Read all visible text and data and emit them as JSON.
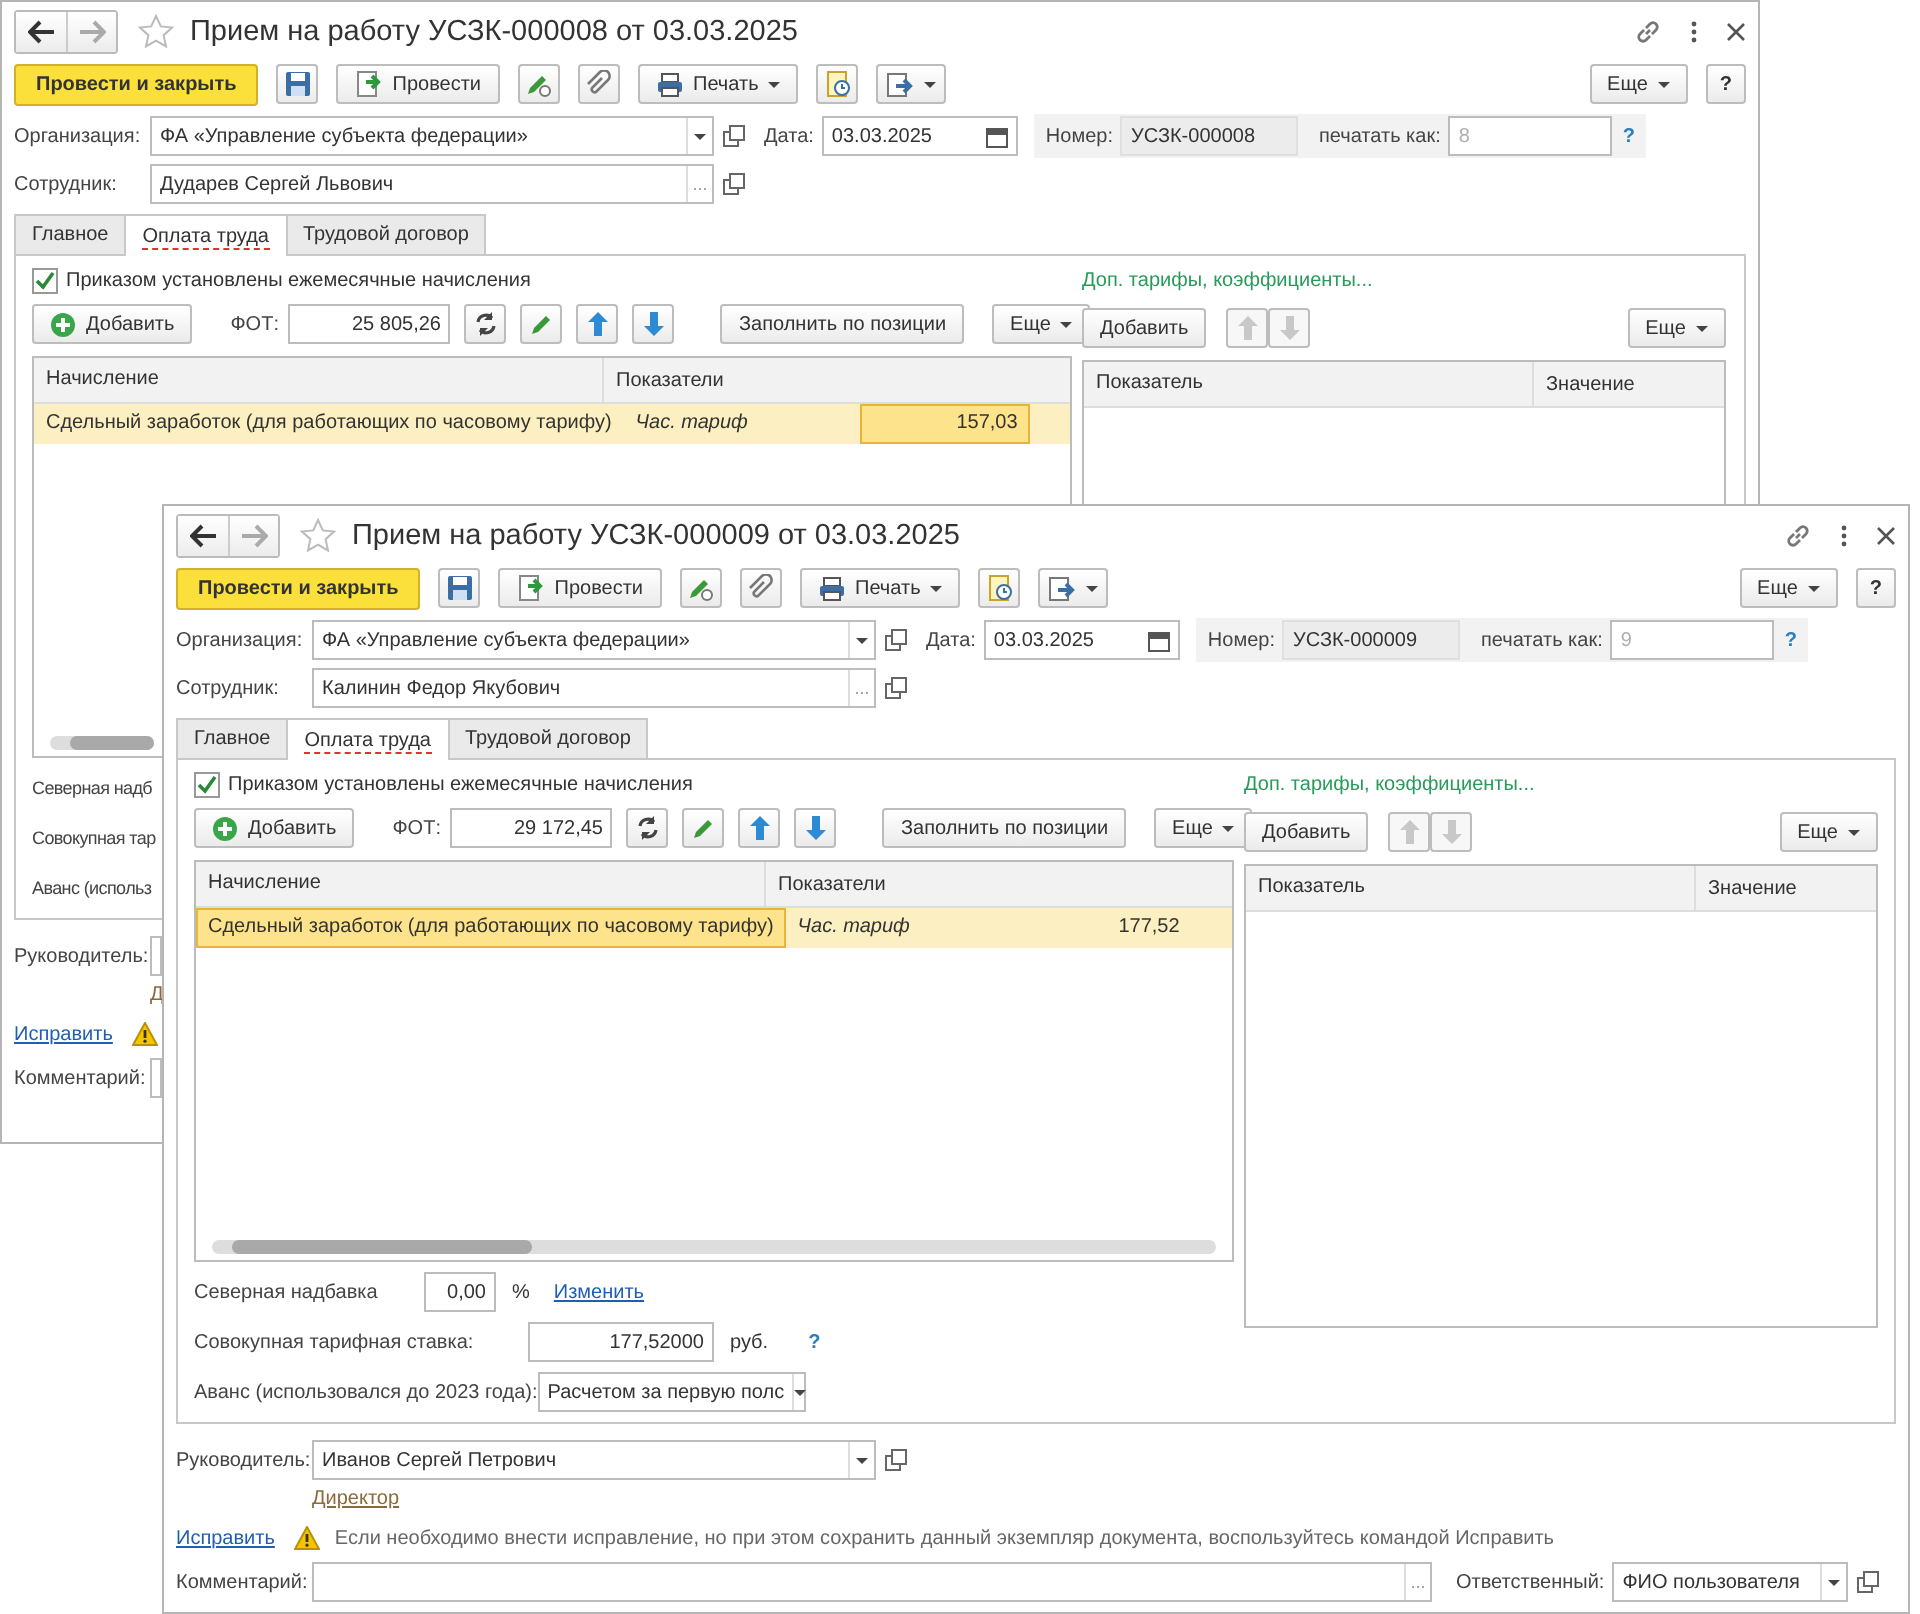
{
  "windows": [
    {
      "kind": "back",
      "title": "Прием на работу УСЗК-000008 от 03.03.2025",
      "toolbar": {
        "post_close": "Провести и закрыть",
        "post": "Провести",
        "print": "Печать",
        "more": "Еще",
        "help": "?"
      },
      "organization": {
        "label": "Организация:",
        "value": "ФА «Управление субъекта федерации»"
      },
      "date": {
        "label": "Дата:",
        "value": "03.03.2025"
      },
      "number": {
        "label": "Номер:",
        "value": "УСЗК-000008"
      },
      "print_as": {
        "label": "печатать как:",
        "value": "8",
        "disabled": true,
        "help": "?"
      },
      "employee": {
        "label": "Сотрудник:",
        "value": "Дударев Сергей Львович",
        "select": "..."
      },
      "tabs": [
        {
          "label": "Главное",
          "selected": false
        },
        {
          "label": "Оплата труда",
          "selected": true
        },
        {
          "label": "Трудовой договор",
          "selected": false
        }
      ],
      "monthly_checkbox": {
        "label": "Приказом установлены ежемесячные начисления",
        "checked": true
      },
      "accruals_toolbar": {
        "add": "Добавить",
        "fot_label": "ФОТ:",
        "fot_value": "25 805,26",
        "fill": "Заполнить по позиции",
        "more": "Еще"
      },
      "accruals_table": {
        "columns": [
          "Начисление",
          "Показатели"
        ],
        "rows": [
          {
            "selected": true,
            "cells": [
              {
                "text": "Сдельный заработок (для работающих по часовому тарифу)",
                "focused": false
              },
              {
                "text": "Час. тариф",
                "focused": false
              },
              {
                "text": "157,03",
                "focused": true
              }
            ]
          }
        ]
      },
      "extra_link": "Доп. тарифы, коэффициенты...",
      "extra_toolbar": {
        "add": "Добавить",
        "more": "Еще"
      },
      "extra_table": {
        "columns": [
          "Показатель",
          "Значение"
        ]
      },
      "north": {
        "label": "Северная надб"
      },
      "total": {
        "label": "Совокупная тар"
      },
      "advance": {
        "label": "Аванс (использ"
      },
      "manager": {
        "label": "Руководитель:"
      },
      "position_link": "Д",
      "fix": {
        "link": "Исправить"
      },
      "comment": {
        "label": "Комментарий:"
      }
    },
    {
      "kind": "front",
      "title": "Прием на работу УСЗК-000009 от 03.03.2025",
      "toolbar": {
        "post_close": "Провести и закрыть",
        "post": "Провести",
        "print": "Печать",
        "more": "Еще",
        "help": "?"
      },
      "organization": {
        "label": "Организация:",
        "value": "ФА «Управление субъекта федерации»"
      },
      "date": {
        "label": "Дата:",
        "value": "03.03.2025"
      },
      "number": {
        "label": "Номер:",
        "value": "УСЗК-000009"
      },
      "print_as": {
        "label": "печатать как:",
        "value": "9",
        "disabled": true,
        "help": "?"
      },
      "employee": {
        "label": "Сотрудник:",
        "value": "Калинин Федор Якубович",
        "select": "..."
      },
      "tabs": [
        {
          "label": "Главное",
          "selected": false
        },
        {
          "label": "Оплата труда",
          "selected": true
        },
        {
          "label": "Трудовой договор",
          "selected": false
        }
      ],
      "monthly_checkbox": {
        "label": "Приказом установлены ежемесячные начисления",
        "checked": true
      },
      "accruals_toolbar": {
        "add": "Добавить",
        "fot_label": "ФОТ:",
        "fot_value": "29 172,45",
        "fill": "Заполнить по позиции",
        "more": "Еще"
      },
      "accruals_table": {
        "columns": [
          "Начисление",
          "Показатели"
        ],
        "rows": [
          {
            "selected": true,
            "cells": [
              {
                "text": "Сдельный заработок (для работающих по часовому тарифу)",
                "focused": true
              },
              {
                "text": "Час. тариф",
                "focused": false
              },
              {
                "text": "177,52",
                "focused": false
              }
            ]
          }
        ]
      },
      "extra_link": "Доп. тарифы, коэффициенты...",
      "extra_toolbar": {
        "add": "Добавить",
        "more": "Еще"
      },
      "extra_table": {
        "columns": [
          "Показатель",
          "Значение"
        ]
      },
      "north": {
        "label": "Северная надбавка",
        "value": "0,00",
        "unit": "%",
        "link": "Изменить"
      },
      "total": {
        "label": "Совокупная тарифная ставка:",
        "value": "177,52000",
        "unit": "руб.",
        "help": "?"
      },
      "advance": {
        "label": "Аванс (использовался до 2023 года):",
        "value": "Расчетом за первую полс"
      },
      "manager": {
        "label": "Руководитель:",
        "value": "Иванов Сергей Петрович"
      },
      "position_link": "Директор",
      "fix": {
        "link": "Исправить",
        "warning": "Если необходимо внести исправление, но при этом сохранить данный экземпляр документа, воспользуйтесь командой Исправить"
      },
      "comment": {
        "label": "Комментарий:",
        "select": "..."
      },
      "responsible": {
        "label": "Ответственный:",
        "value": "ФИО пользователя"
      }
    }
  ]
}
